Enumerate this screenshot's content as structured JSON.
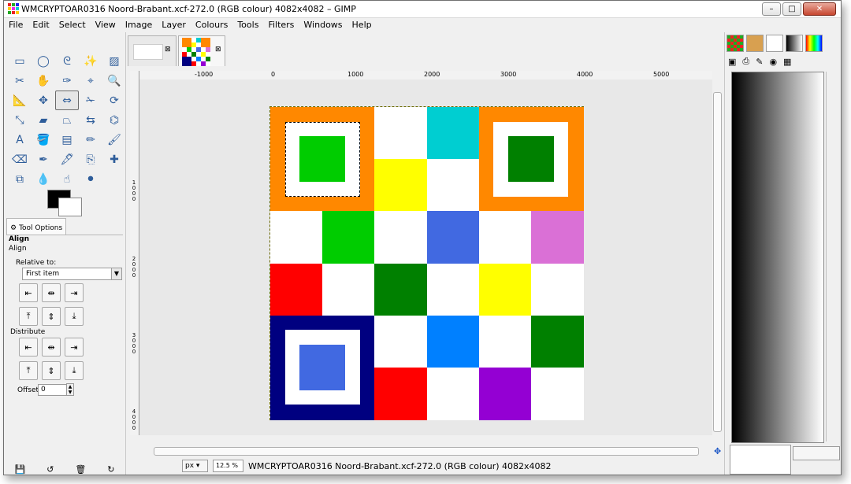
{
  "window": {
    "title": "WMCRYPTOAR0316 Noord-Brabant.xcf-272.0 (RGB colour) 4082x4082 – GIMP",
    "controls": {
      "minimize": "–",
      "maximize": "□",
      "close": "✕"
    }
  },
  "menubar": {
    "items": [
      {
        "label": "File"
      },
      {
        "label": "Edit"
      },
      {
        "label": "Select"
      },
      {
        "label": "View"
      },
      {
        "label": "Image"
      },
      {
        "label": "Layer"
      },
      {
        "label": "Colours"
      },
      {
        "label": "Tools"
      },
      {
        "label": "Filters"
      },
      {
        "label": "Windows"
      },
      {
        "label": "Help"
      }
    ]
  },
  "toolbox": {
    "tools": [
      "rect-select-icon",
      "ellipse-select-icon",
      "free-select-icon",
      "fuzzy-select-icon",
      "select-by-color-icon",
      "scissors-select-icon",
      "foreground-select-icon",
      "paths-icon",
      "color-picker-icon",
      "zoom-icon",
      "measure-icon",
      "move-icon",
      "align-icon",
      "crop-icon",
      "rotate-icon",
      "scale-icon",
      "shear-icon",
      "perspective-icon",
      "flip-icon",
      "cage-transform-icon",
      "text-icon",
      "bucket-fill-icon",
      "blend-icon",
      "pencil-icon",
      "paintbrush-icon",
      "eraser-icon",
      "airbrush-icon",
      "ink-icon",
      "clone-icon",
      "heal-icon",
      "perspective-clone-icon",
      "blur-icon",
      "smudge-icon",
      "dodge-burn-icon"
    ],
    "selected_tool_index": 12
  },
  "tool_options": {
    "tab_label": "Tool Options",
    "heading": "Align",
    "subheading": "Align",
    "relative_to_label": "Relative to:",
    "relative_to_value": "First item",
    "distribute_label": "Distribute",
    "offset_label": "Offset:",
    "offset_value": "0"
  },
  "rulers": {
    "h_labels": [
      "-1000",
      "0",
      "1000",
      "2000",
      "3000",
      "4000",
      "5000"
    ],
    "v_labels": [
      "1000",
      "2000",
      "3000",
      "4000"
    ]
  },
  "image_grid": {
    "rows": [
      [
        "#ff8800",
        "#ff8800",
        "#ffffff",
        "#00ced1",
        "#ff8800",
        "#ff8800"
      ],
      [
        "#ff8800",
        "#ff8800",
        "#ffff00",
        "#ffffff",
        "#ff8800",
        "#ff8800"
      ],
      [
        "#ffffff",
        "#00cc00",
        "#ffffff",
        "#4169e1",
        "#ffffff",
        "#da70d6"
      ],
      [
        "#ff0000",
        "#ffffff",
        "#008000",
        "#ffffff",
        "#ffff00",
        "#ffffff"
      ],
      [
        "#000080",
        "#000080",
        "#ffffff",
        "#0080ff",
        "#ffffff",
        "#008000"
      ],
      [
        "#000080",
        "#000080",
        "#ff0000",
        "#ffffff",
        "#9400d3",
        "#ffffff"
      ]
    ],
    "nested_squares": [
      {
        "outer": "#ff8800",
        "inner": "#00cc00"
      },
      {
        "outer": "#ff8800",
        "inner": "#008000"
      },
      {
        "outer": "#000080",
        "inner": "#4169e1"
      }
    ]
  },
  "statusbar": {
    "unit": "px",
    "zoom": "12.5 %",
    "text": "WMCRYPTOAR0316 Noord-Brabant.xcf-272.0 (RGB colour) 4082x4082"
  }
}
